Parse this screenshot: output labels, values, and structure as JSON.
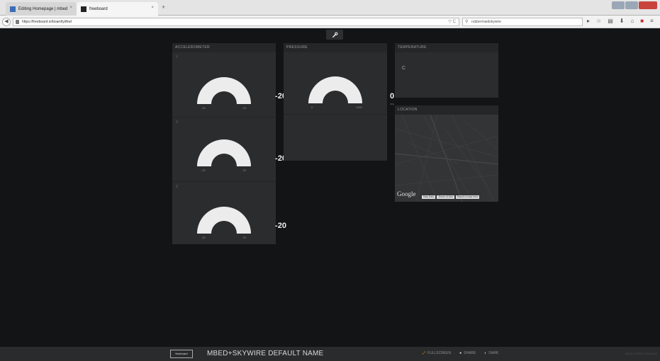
{
  "browser": {
    "tabs": [
      {
        "label": "Editing Homepage | mbed"
      },
      {
        "label": "freeboard"
      }
    ],
    "url": "https://freeboard.io/board/ydhwl",
    "search_placeholder": "rubbermaidskywire"
  },
  "panels": {
    "accelerometer": {
      "title": "ACCELEROMETER",
      "gauges": [
        {
          "label": "Y",
          "value": "-20",
          "min": "-20",
          "max": "20"
        },
        {
          "label": "X",
          "value": "-20",
          "min": "-20",
          "max": "20"
        },
        {
          "label": "Z",
          "value": "-20",
          "min": "-20",
          "max": "20"
        }
      ]
    },
    "pressure": {
      "title": "PRESSURE",
      "value": "0",
      "units": "hPa",
      "min": "0",
      "max": "1000"
    },
    "temperature": {
      "title": "TEMPERATURE",
      "value": "C"
    },
    "location": {
      "title": "LOCATION",
      "logo": "Google",
      "links": [
        "Map Data",
        "Terms of Use",
        "Report a map error"
      ]
    }
  },
  "footer": {
    "logo": "freeboard",
    "dashboard_name": "MBED+SKYWIRE DEFAULT NAME",
    "fullscreen": "FULLSCREEN",
    "share": "SHARE",
    "dark": "DARK",
    "dev_console": "DEVELOPER CONSOLE"
  },
  "colors": {
    "background": "#131416",
    "panel": "#2b2c2e",
    "gauge_fill": "#ececec",
    "accent": "#e6b800"
  }
}
